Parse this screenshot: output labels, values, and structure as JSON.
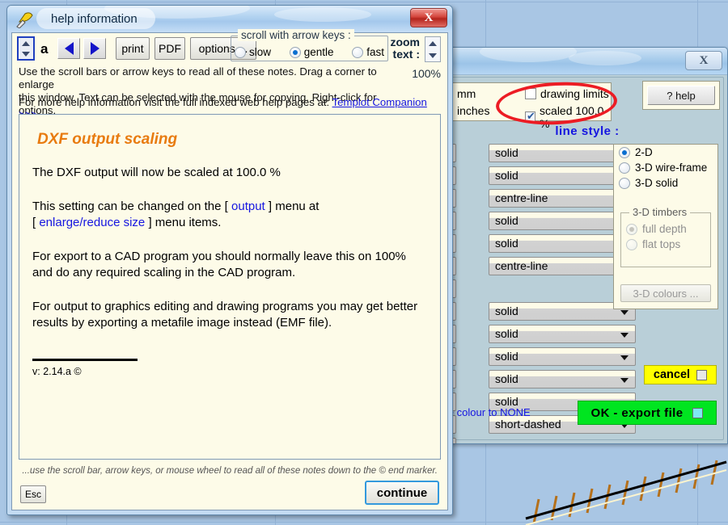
{
  "help_window": {
    "title": "help  information",
    "app_icon": "templot-icon",
    "close_label": "X",
    "toolbar": {
      "font_size_spinner": "font-size-spinner",
      "letter_a": "a",
      "back_label": "◀",
      "forward_label": "▶",
      "print_label": "print",
      "pdf_label": "PDF",
      "options_label": "options ...",
      "scroll_group_label": "scroll  with  arrow  keys :",
      "scroll_options": [
        {
          "label": "slow",
          "selected": false
        },
        {
          "label": "gentle",
          "selected": true
        },
        {
          "label": "fast",
          "selected": false
        }
      ],
      "zoom_label_line1": "zoom",
      "zoom_label_line2": "text :",
      "zoom_percent": "100%"
    },
    "intro_line1": "Use the scroll bars or arrow keys to read all of these notes. Drag a corner to enlarge",
    "intro_line2": "this window. Text can be selected with the mouse for copying. Right-click for options.",
    "weblink_prefix": "For more help information visit the full indexed web help pages at:",
    "weblink_text": "Templot Companion >>>",
    "note": {
      "heading": "DXF output scaling",
      "para1": "The DXF output will now be scaled at 100.0 %",
      "para2_a": "This setting can be changed on the [",
      "para2_link1": "output",
      "para2_b": "] menu at",
      "para2_c": "[",
      "para2_link2": "enlarge/reduce size",
      "para2_d": "] menu items.",
      "para3": "For export to a CAD program you should normally leave this on 100% and do any required scaling in the CAD program.",
      "para4": "For output to graphics editing and drawing programs you may get better results by exporting a metafile image instead (EMF file).",
      "version": "v: 2.14.a  ©"
    },
    "footnote": "...use the scroll bar, arrow keys, or mouse wheel to read all of these notes down to the © end marker.",
    "esc_label": "Esc",
    "continue_label": "continue"
  },
  "export_dialog": {
    "close_label": "X",
    "help_button": "? help",
    "units": [
      {
        "label": "mm"
      },
      {
        "label": "inches"
      }
    ],
    "checkboxes": [
      {
        "label": "drawing  limits",
        "checked": false
      },
      {
        "label": "scaled  100.0 %",
        "checked": true
      }
    ],
    "line_style_title": "line  style :",
    "rows": [
      {
        "style": "solid"
      },
      {
        "style": "solid"
      },
      {
        "style": "centre-line"
      },
      {
        "style": "solid"
      },
      {
        "style": "solid"
      },
      {
        "style": "centre-line"
      },
      {
        "style": ""
      },
      {
        "style": "solid"
      },
      {
        "style": "solid"
      },
      {
        "style": "solid"
      },
      {
        "style": "solid"
      },
      {
        "style": "solid"
      },
      {
        "style": "short-dashed"
      },
      {
        "style": ""
      }
    ],
    "dimension_options": [
      {
        "label": "2-D",
        "selected": true,
        "disabled": false
      },
      {
        "label": "3-D  wire-frame",
        "selected": false,
        "disabled": false
      },
      {
        "label": "3-D  solid",
        "selected": false,
        "disabled": false
      }
    ],
    "timbers_group_label": "3-D  timbers",
    "timber_options": [
      {
        "label": "full  depth",
        "selected": true,
        "disabled": true
      },
      {
        "label": "flat  tops",
        "selected": false,
        "disabled": true
      }
    ],
    "colours_button": "3-D colours ...",
    "none_note": "set the colour to NONE",
    "cancel_label": "cancel",
    "ok_label": "OK  -  export  file"
  },
  "annotation": {
    "type": "red-ellipse-highlight",
    "color": "#ec1c24",
    "targets": "scaled 100.0 % checkbox"
  }
}
